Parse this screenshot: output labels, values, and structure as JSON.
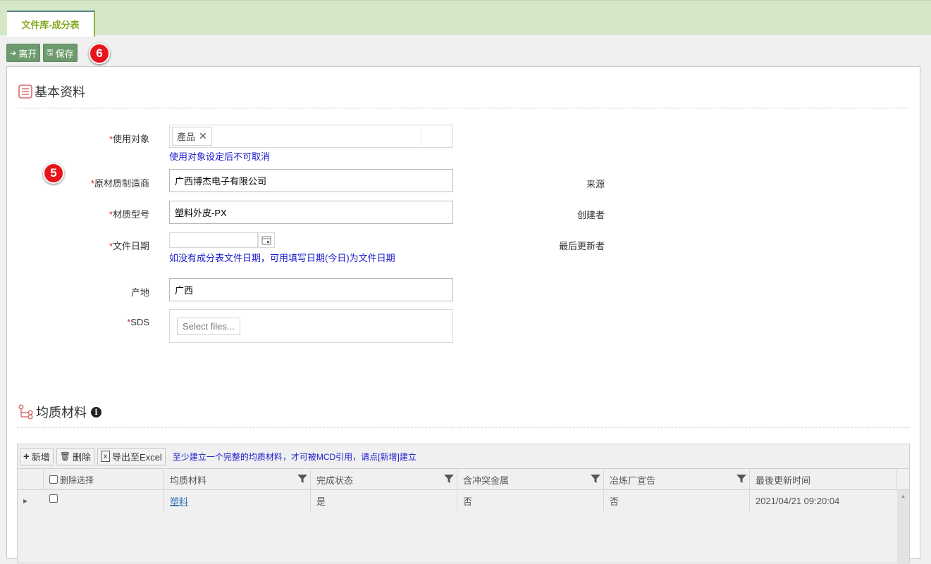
{
  "tab": {
    "label": "文件库-成分表"
  },
  "toolbar": {
    "leave_label": "离开",
    "save_label": "保存"
  },
  "badges": {
    "toolbar_badge": "6",
    "form_badge": "5"
  },
  "basic": {
    "title": "基本资料",
    "fields": {
      "target": {
        "label": "使用对象",
        "tag": "產品",
        "hint": "使用对象设定后不可取消"
      },
      "manufacturer": {
        "label": "原材质制造商",
        "value": "广西博杰电子有限公司"
      },
      "model": {
        "label": "材质型号",
        "value": "塑料外皮-PX"
      },
      "doc_date": {
        "label": "文件日期",
        "value": "",
        "hint": "如没有成分表文件日期，可用填写日期(今日)为文件日期"
      },
      "origin": {
        "label": "产地",
        "value": "广西"
      },
      "sds": {
        "label": "SDS",
        "button": "Select files..."
      }
    },
    "right_labels": {
      "source": "来源",
      "creator": "创建者",
      "last_updater": "最后更新者"
    }
  },
  "homogeneous": {
    "title": "均质材料",
    "toolbar": {
      "add": "新增",
      "delete": "删除",
      "export": "导出至Excel",
      "hint": "至少建立一个完整的均质材料，才可被MCD引用，请点[新增]建立"
    },
    "columns": [
      "删除选择",
      "均质材料",
      "完成状态",
      "含冲突金属",
      "冶炼厂宣告",
      "最後更新时间"
    ],
    "rows": [
      {
        "material": "塑料",
        "status": "是",
        "conflict_metal": "否",
        "smelter": "否",
        "updated": "2021/04/21 09:20:04"
      }
    ]
  }
}
